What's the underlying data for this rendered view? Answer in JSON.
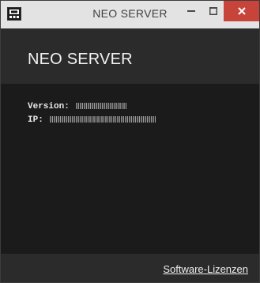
{
  "window": {
    "title": "NEO SERVER",
    "icon": "app-icon",
    "controls": {
      "minimize_icon": "minimize-icon",
      "maximize_icon": "maximize-icon",
      "close_icon": "close-icon",
      "close_color": "#c7443b"
    }
  },
  "header": {
    "title": "NEO SERVER"
  },
  "info": {
    "version_label": "Version:",
    "ip_label": "IP:"
  },
  "footer": {
    "license_link": "Software-Lizenzen"
  },
  "colors": {
    "titlebar": "#e3e3e3",
    "header_bg": "#2b2b2b",
    "content_bg": "#1b1b1b",
    "close_button": "#c7443b"
  }
}
